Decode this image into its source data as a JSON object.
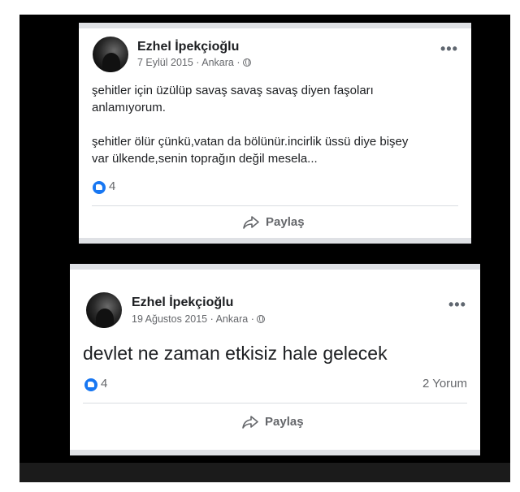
{
  "posts": [
    {
      "author": "Ezhel İpekçioğlu",
      "date": "7 Eylül 2015",
      "location": "Ankara",
      "text": "şehitler için üzülüp savaş savaş savaş diyen faşoları\nanlamıyorum.\n\nşehitler ölür çünkü,vatan da bölünür.incirlik üssü diye bişey\nvar ülkende,senin toprağın değil mesela...",
      "likes": "4",
      "share_label": "Paylaş"
    },
    {
      "author": "Ezhel İpekçioğlu",
      "date": "19 Ağustos 2015",
      "location": "Ankara",
      "text": "devlet ne zaman etkisiz hale gelecek",
      "likes": "4",
      "comments": "2 Yorum",
      "share_label": "Paylaş"
    }
  ],
  "meta_separator": "·",
  "more_label": "•••",
  "icons": {
    "privacy": "globe-icon",
    "reaction": "like-icon",
    "share": "share-arrow-icon"
  },
  "colors": {
    "reaction_blue": "#1877f2",
    "text": "#1c1e21",
    "muted": "#65676b"
  }
}
